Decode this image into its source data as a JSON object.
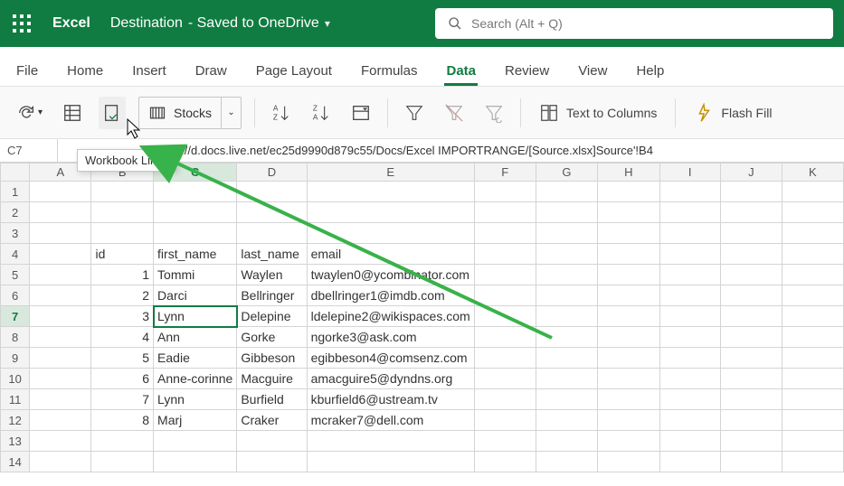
{
  "app": {
    "name": "Excel"
  },
  "document": {
    "title": "Destination",
    "saved_note": " -  Saved to OneDrive"
  },
  "search": {
    "placeholder": "Search (Alt + Q)"
  },
  "tabs": {
    "file": "File",
    "home": "Home",
    "insert": "Insert",
    "draw": "Draw",
    "page_layout": "Page Layout",
    "formulas": "Formulas",
    "data": "Data",
    "review": "Review",
    "view": "View",
    "help": "Help",
    "active": "data"
  },
  "ribbon": {
    "stocks_label": "Stocks",
    "text_to_columns": "Text to Columns",
    "flash_fill": "Flash Fill"
  },
  "tooltip": {
    "workbook_links": "Workbook Links"
  },
  "namebox": {
    "ref": "C7"
  },
  "formula": {
    "prefix": "'https://d.docs.live.net/ec25d9990d879c55/Docs/Excel IMPORTRANGE/[Source.xlsx]Source'!B4"
  },
  "columns": [
    "A",
    "B",
    "C",
    "D",
    "E",
    "F",
    "G",
    "H",
    "I",
    "J",
    "K"
  ],
  "rows": {
    "count": 14
  },
  "selection": {
    "row": 7,
    "col": "C"
  },
  "headers": {
    "row": 4,
    "b": "id",
    "c": "first_name",
    "d": "last_name",
    "e": "email"
  },
  "data_rows": [
    {
      "row": 5,
      "id": 1,
      "first": "Tommi",
      "last": "Waylen",
      "email": "twaylen0@ycombinator.com"
    },
    {
      "row": 6,
      "id": 2,
      "first": "Darci",
      "last": "Bellringer",
      "email": "dbellringer1@imdb.com"
    },
    {
      "row": 7,
      "id": 3,
      "first": "Lynn",
      "last": "Delepine",
      "email": "ldelepine2@wikispaces.com"
    },
    {
      "row": 8,
      "id": 4,
      "first": "Ann",
      "last": "Gorke",
      "email": "ngorke3@ask.com"
    },
    {
      "row": 9,
      "id": 5,
      "first": "Eadie",
      "last": "Gibbeson",
      "email": "egibbeson4@comsenz.com"
    },
    {
      "row": 10,
      "id": 6,
      "first": "Anne-corinne",
      "last": "Macguire",
      "email": "amacguire5@dyndns.org"
    },
    {
      "row": 11,
      "id": 7,
      "first": "Lynn",
      "last": "Burfield",
      "email": "kburfield6@ustream.tv"
    },
    {
      "row": 12,
      "id": 8,
      "first": "Marj",
      "last": "Craker",
      "email": "mcraker7@dell.com"
    }
  ],
  "icons": {
    "waffle": "app-launcher-icon",
    "chevron": "chevron-down-icon",
    "search": "search-icon",
    "refresh": "refresh-all-icon",
    "crosstab": "from-table-icon",
    "wblinks": "workbook-links-icon",
    "stocks": "stocks-icon",
    "sortaz": "sort-az-icon",
    "sortza": "sort-za-icon",
    "customsort": "custom-sort-icon",
    "filter": "filter-icon",
    "clearf": "clear-filter-icon",
    "reapply": "reapply-icon",
    "ttc": "text-to-columns-icon",
    "ff": "flash-fill-icon"
  }
}
